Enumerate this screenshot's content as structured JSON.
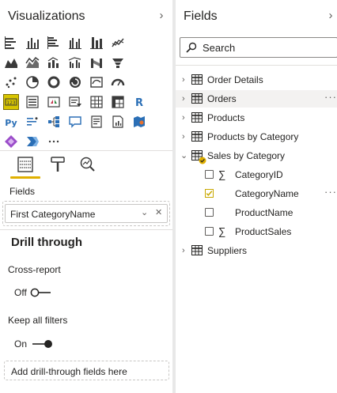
{
  "visualizations": {
    "title": "Visualizations",
    "collapse_icon": "chevron-right-icon",
    "icons": [
      "stacked-bar-chart",
      "stacked-column-chart",
      "clustered-bar-chart",
      "clustered-column-chart",
      "100-stacked-bar-chart",
      "line-chart",
      "area-chart",
      "stacked-area-chart",
      "line-and-column-chart",
      "line-and-clustered-column-chart",
      "ribbon-chart",
      "waterfall-chart",
      "scatter-chart",
      "pie-chart",
      "donut-chart",
      "treemap",
      "map",
      "gauge",
      "card",
      "multi-row-card",
      "kpi",
      "slicer",
      "table",
      "matrix",
      "r-visual",
      "python-visual",
      "key-influencers",
      "decomposition-tree",
      "qa",
      "smart-narrative",
      "paginated-report",
      "arcgis-map",
      "power-apps",
      "power-automate",
      "more-visuals"
    ],
    "selected_icon": "card",
    "tabs": [
      "fields-tab",
      "format-tab",
      "analytics-tab"
    ],
    "active_tab": "fields-tab",
    "fields_label": "Fields",
    "field_well_value": "First CategoryName",
    "drill_through": {
      "title": "Drill through",
      "cross_report_label": "Cross-report",
      "cross_report_state": "Off",
      "keep_filters_label": "Keep all filters",
      "keep_filters_state": "On",
      "add_fields_placeholder": "Add drill-through fields here"
    },
    "accent": "#e0b000"
  },
  "fields": {
    "title": "Fields",
    "collapse_icon": "chevron-right-icon",
    "search_placeholder": "Search",
    "tables": [
      {
        "name": "Order Details"
      },
      {
        "name": "Orders",
        "more": "···"
      },
      {
        "name": "Products"
      },
      {
        "name": "Products by Category"
      },
      {
        "name": "Sales by Category",
        "expanded": true,
        "fields": [
          {
            "name": "CategoryID",
            "sigma": "∑",
            "checked": false
          },
          {
            "name": "CategoryName",
            "checked": true,
            "more": "···"
          },
          {
            "name": "ProductName",
            "checked": false
          },
          {
            "name": "ProductSales",
            "sigma": "∑",
            "checked": false
          }
        ]
      },
      {
        "name": "Suppliers"
      }
    ]
  }
}
